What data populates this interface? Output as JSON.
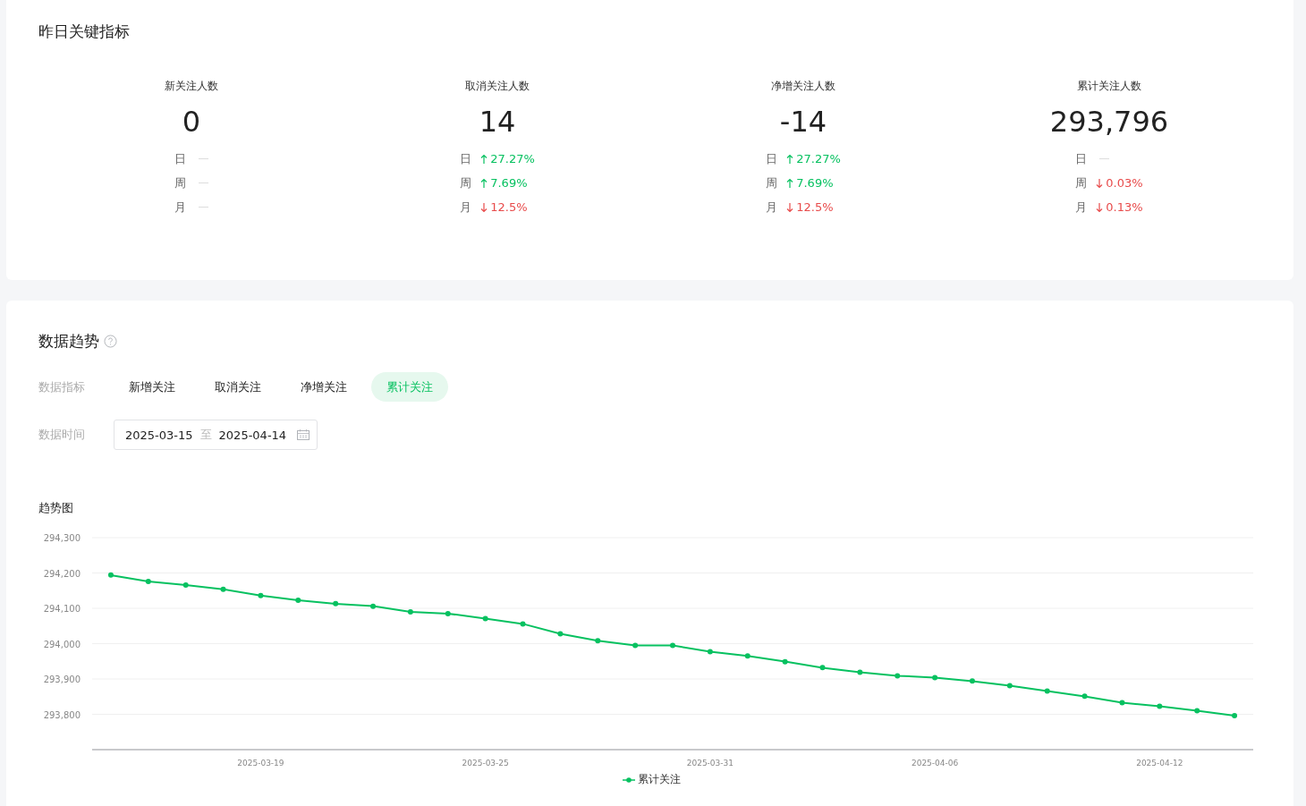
{
  "key_metrics": {
    "title": "昨日关键指标",
    "items": [
      {
        "label": "新关注人数",
        "value": "0",
        "deltas": [
          {
            "period": "日",
            "kind": "none"
          },
          {
            "period": "周",
            "kind": "none"
          },
          {
            "period": "月",
            "kind": "none"
          }
        ]
      },
      {
        "label": "取消关注人数",
        "value": "14",
        "deltas": [
          {
            "period": "日",
            "kind": "up",
            "text": "27.27%"
          },
          {
            "period": "周",
            "kind": "up",
            "text": "7.69%"
          },
          {
            "period": "月",
            "kind": "down",
            "text": "12.5%"
          }
        ]
      },
      {
        "label": "净增关注人数",
        "value": "-14",
        "deltas": [
          {
            "period": "日",
            "kind": "up",
            "text": "27.27%"
          },
          {
            "period": "周",
            "kind": "up",
            "text": "7.69%"
          },
          {
            "period": "月",
            "kind": "down",
            "text": "12.5%"
          }
        ]
      },
      {
        "label": "累计关注人数",
        "value": "293,796",
        "deltas": [
          {
            "period": "日",
            "kind": "none"
          },
          {
            "period": "周",
            "kind": "down",
            "text": "0.03%"
          },
          {
            "period": "月",
            "kind": "down",
            "text": "0.13%"
          }
        ]
      }
    ]
  },
  "trend": {
    "title": "数据趋势",
    "metric_label": "数据指标",
    "metric_tabs": [
      {
        "label": "新增关注",
        "selected": false
      },
      {
        "label": "取消关注",
        "selected": false
      },
      {
        "label": "净增关注",
        "selected": false
      },
      {
        "label": "累计关注",
        "selected": true
      }
    ],
    "time_label": "数据时间",
    "date_start": "2025-03-15",
    "date_separator": "至",
    "date_end": "2025-04-14",
    "chart_title": "趋势图",
    "chart_data": {
      "type": "line",
      "categories": [
        null,
        null,
        null,
        null,
        "2025-03-19",
        null,
        null,
        null,
        null,
        null,
        "2025-03-25",
        null,
        null,
        null,
        null,
        null,
        "2025-03-31",
        null,
        null,
        null,
        null,
        null,
        "2025-04-06",
        null,
        null,
        null,
        null,
        null,
        "2025-04-12",
        null,
        null
      ],
      "grid": true,
      "series": [
        {
          "name": "累计关注",
          "color": "#07c160",
          "marker": "circle",
          "values": [
            294194,
            294176,
            294166,
            294154,
            294136,
            294123,
            294113,
            294106,
            294090,
            294085,
            294071,
            294056,
            294028,
            294008,
            293995,
            293995,
            293977,
            293965,
            293949,
            293932,
            293919,
            293909,
            293904,
            293894,
            293881,
            293866,
            293851,
            293833,
            293823,
            293810,
            293796
          ]
        }
      ],
      "ylim": [
        293700,
        294300
      ],
      "yticks": [
        {
          "value": 293800,
          "label": "293,800"
        },
        {
          "value": 293900,
          "label": "293,900"
        },
        {
          "value": 294000,
          "label": "294,000"
        },
        {
          "value": 294100,
          "label": "294,100"
        },
        {
          "value": 294200,
          "label": "294,200"
        },
        {
          "value": 294300,
          "label": "294,300"
        }
      ]
    }
  }
}
